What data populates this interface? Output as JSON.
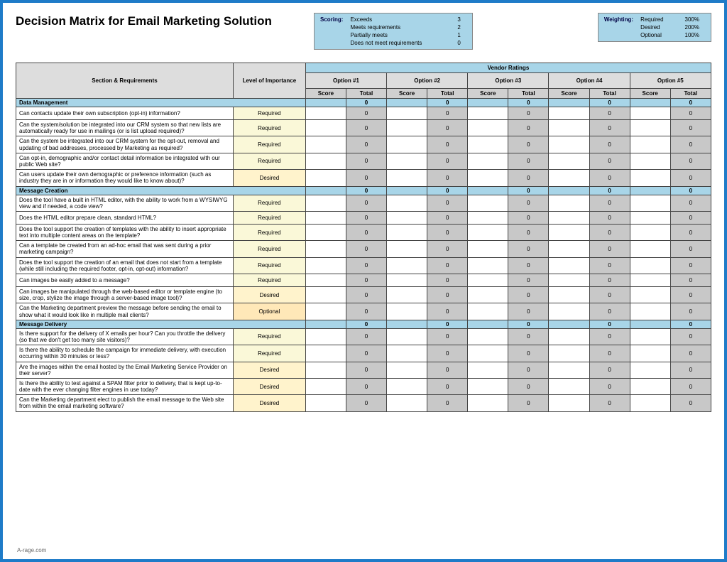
{
  "title": "Decision Matrix for Email Marketing Solution",
  "scoring": {
    "label": "Scoring:",
    "rows": [
      {
        "name": "Exceeds",
        "value": "3"
      },
      {
        "name": "Meets requirements",
        "value": "2"
      },
      {
        "name": "Partially meets",
        "value": "1"
      },
      {
        "name": "Does not meet requirements",
        "value": "0"
      }
    ]
  },
  "weighting": {
    "label": "Weighting:",
    "rows": [
      {
        "name": "Required",
        "value": "300%"
      },
      {
        "name": "Desired",
        "value": "200%"
      },
      {
        "name": "Optional",
        "value": "100%"
      }
    ]
  },
  "headers": {
    "section_req": "Section & Requirements",
    "level": "Level of Importance",
    "vendor_ratings": "Vendor Ratings",
    "options": [
      "Option #1",
      "Option #2",
      "Option #3",
      "Option #4",
      "Option #5"
    ],
    "score": "Score",
    "total": "Total"
  },
  "sections": [
    {
      "name": "Data Management",
      "totals": [
        "0",
        "0",
        "0",
        "0",
        "0"
      ],
      "rows": [
        {
          "req": "Can contacts update their own subscription (opt-in) information?",
          "imp": "Required"
        },
        {
          "req": "Can the system/solution be integrated into our CRM system so that new lists are automatically ready for use in mailings (or is list upload required)?",
          "imp": "Required"
        },
        {
          "req": "Can the system be integrated into our CRM system for the opt-out, removal and updating of bad addresses, processed by Marketing as required?",
          "imp": "Required"
        },
        {
          "req": "Can opt-in, demographic and/or contact detail information be integrated with our public Web site?",
          "imp": "Required"
        },
        {
          "req": "Can users update their own demographic or preference information (such as industry they are in or information they would like to know about)?",
          "imp": "Desired"
        }
      ]
    },
    {
      "name": "Message Creation",
      "totals": [
        "0",
        "0",
        "0",
        "0",
        "0"
      ],
      "rows": [
        {
          "req": "Does the tool have a built in HTML editor, with the ability to work from a WYSIWYG view and if needed, a code view?",
          "imp": "Required"
        },
        {
          "req": "Does the HTML editor prepare clean, standard HTML?",
          "imp": "Required"
        },
        {
          "req": "Does the tool support the creation of templates with the ability to insert appropriate text into multiple content areas on the template?",
          "imp": "Required"
        },
        {
          "req": "Can a template be created from an ad-hoc email that was sent during a prior marketing campaign?",
          "imp": "Required"
        },
        {
          "req": "Does the tool support the creation of an email that does not start from a template (while still including the required footer, opt-in, opt-out) information?",
          "imp": "Required"
        },
        {
          "req": "Can images be easily added to a message?",
          "imp": "Required"
        },
        {
          "req": "Can images be manipulated through the web-based editor or template engine (to size, crop, stylize the image through a server-based image tool)?",
          "imp": "Desired"
        },
        {
          "req": "Can the Marketing department preview the message before sending the email to show what it would look like in multiple mail clients?",
          "imp": "Optional"
        }
      ]
    },
    {
      "name": "Message Delivery",
      "totals": [
        "0",
        "0",
        "0",
        "0",
        "0"
      ],
      "rows": [
        {
          "req": "Is there support for the delivery of X emails per hour?  Can you throttle the delivery (so that we don't get too many site visitors)?",
          "imp": "Required"
        },
        {
          "req": "Is there the ability to schedule the campaign for immediate delivery, with execution occurring within 30 minutes or less?",
          "imp": "Required"
        },
        {
          "req": "Are the images within the email hosted by the Email Marketing Service Provider on their server?",
          "imp": "Desired"
        },
        {
          "req": "Is there the ability to test against a SPAM filter prior to delivery, that is kept up-to-date with the ever changing filter engines in use today?",
          "imp": "Desired"
        },
        {
          "req": "Can the Marketing department elect to publish the email message to the Web site from within the email marketing software?",
          "imp": "Desired"
        }
      ]
    }
  ],
  "footer": "A-rage.com",
  "zero": "0"
}
